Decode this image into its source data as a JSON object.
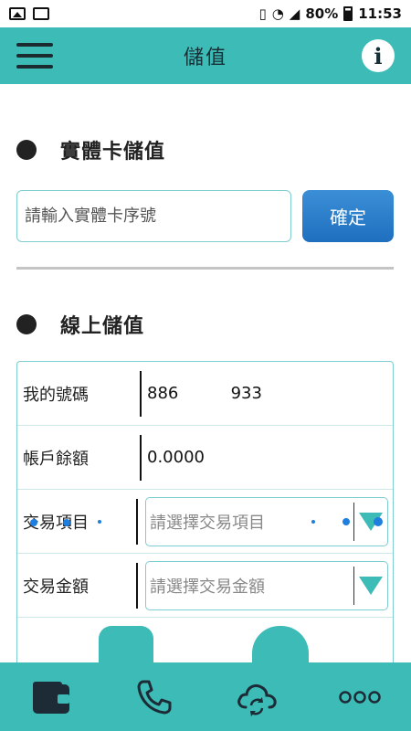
{
  "status_bar": {
    "battery": "80%",
    "time": "11:53"
  },
  "app_bar": {
    "title": "儲值",
    "info_label": "i"
  },
  "physical_card": {
    "title": "實體卡儲值",
    "input_placeholder": "請輸入實體卡序號",
    "confirm_label": "確定"
  },
  "online": {
    "title": "線上儲值",
    "rows": [
      {
        "label": "我的號碼",
        "value": "886          933"
      },
      {
        "label": "帳戶餘額",
        "value": "0.0000"
      },
      {
        "label": "交易項目",
        "placeholder": "請選擇交易項目"
      },
      {
        "label": "交易金額",
        "placeholder": "請選擇交易金額"
      }
    ]
  },
  "bottom_nav": [
    "wallet-icon",
    "phone-icon",
    "cloud-sync-icon",
    "more-icon"
  ],
  "colors": {
    "accent": "#3dbbb6",
    "button_blue": "#2a7fd0"
  }
}
